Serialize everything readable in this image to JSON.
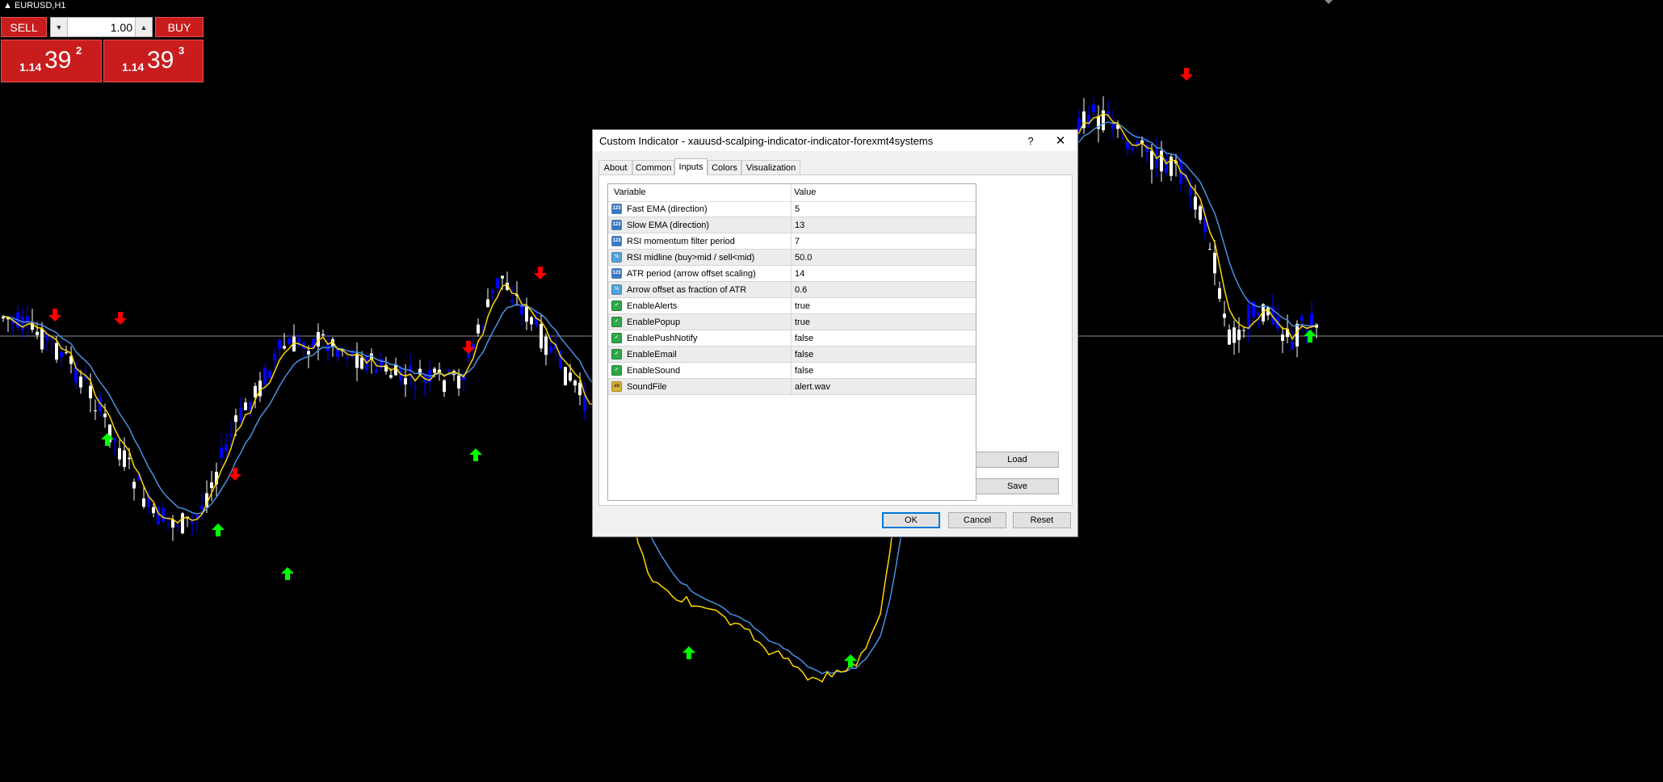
{
  "window": {
    "symbol_title": "EURUSD,H1"
  },
  "trade_panel": {
    "sell_label": "SELL",
    "buy_label": "BUY",
    "lot_value": "1.00",
    "sell_price": {
      "small": "1.14",
      "big": "39",
      "sup": "2"
    },
    "buy_price": {
      "small": "1.14",
      "big": "39",
      "sup": "3"
    }
  },
  "dialog": {
    "title": "Custom Indicator - xauusd-scalping-indicator-indicator-forexmt4systems",
    "help_glyph": "?",
    "close_glyph": "✕",
    "tabs": [
      {
        "label": "About"
      },
      {
        "label": "Common"
      },
      {
        "label": "Inputs"
      },
      {
        "label": "Colors"
      },
      {
        "label": "Visualization"
      }
    ],
    "active_tab": "Inputs",
    "table": {
      "headers": {
        "variable": "Variable",
        "value": "Value"
      },
      "rows": [
        {
          "icon": "int-param-icon",
          "type_code": "123",
          "name": "Fast EMA (direction)",
          "value": "5"
        },
        {
          "icon": "int-param-icon",
          "type_code": "123",
          "name": "Slow EMA (direction)",
          "value": "13"
        },
        {
          "icon": "int-param-icon",
          "type_code": "123",
          "name": "RSI momentum filter period",
          "value": "7"
        },
        {
          "icon": "double-param-icon",
          "type_code": "½",
          "name": "RSI midline (buy>mid / sell<mid)",
          "value": "50.0"
        },
        {
          "icon": "int-param-icon",
          "type_code": "123",
          "name": "ATR period (arrow offset scaling)",
          "value": "14"
        },
        {
          "icon": "double-param-icon",
          "type_code": "½",
          "name": "Arrow offset as fraction of ATR",
          "value": "0.6"
        },
        {
          "icon": "bool-param-icon",
          "type_code": "✓",
          "name": "EnableAlerts",
          "value": "true"
        },
        {
          "icon": "bool-param-icon",
          "type_code": "✓",
          "name": "EnablePopup",
          "value": "true"
        },
        {
          "icon": "bool-param-icon",
          "type_code": "✓",
          "name": "EnablePushNotify",
          "value": "false"
        },
        {
          "icon": "bool-param-icon",
          "type_code": "✓",
          "name": "EnableEmail",
          "value": "false"
        },
        {
          "icon": "bool-param-icon",
          "type_code": "✓",
          "name": "EnableSound",
          "value": "false"
        },
        {
          "icon": "string-param-icon",
          "type_code": "ab",
          "name": "SoundFile",
          "value": "alert.wav"
        }
      ]
    },
    "side_buttons": {
      "load": "Load",
      "save": "Save"
    },
    "footer_buttons": {
      "ok": "OK",
      "cancel": "Cancel",
      "reset": "Reset"
    }
  },
  "colors": {
    "background": "#000000",
    "bull_candle": "#ffffff",
    "bear_candle": "#0000ff",
    "fast_ema": "#ffd700",
    "slow_ema": "#4a90e2",
    "up_arrow": "#00ff00",
    "down_arrow": "#ff0000",
    "sell_buy_panel": "#c91d1d"
  }
}
